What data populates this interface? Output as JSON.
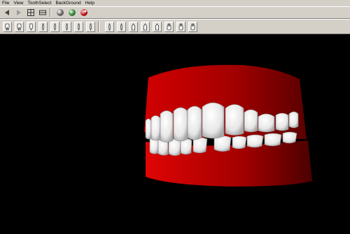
{
  "menu": {
    "items": [
      "File",
      "View",
      "ToothSelect",
      "BackGround",
      "Help"
    ]
  },
  "toolbar_main": {
    "buttons": [
      {
        "icon": "arrow-left-icon"
      },
      {
        "icon": "arrow-right-icon"
      },
      {
        "icon": "zoom-icon"
      },
      {
        "icon": "fit-view-icon"
      },
      {
        "icon": "sphere-shading-icon"
      },
      {
        "icon": "green-sphere-icon"
      },
      {
        "icon": "red-sphere-icon"
      }
    ]
  },
  "toolbar_teeth": {
    "groups": [
      {
        "count": 8,
        "icon": "tooth-upper-icon"
      },
      {
        "count": 8,
        "icon": "tooth-lower-icon"
      }
    ]
  },
  "scene": {
    "background": "#000000",
    "gum_color": "#c80000",
    "teeth_color": "#f2f2f2"
  }
}
